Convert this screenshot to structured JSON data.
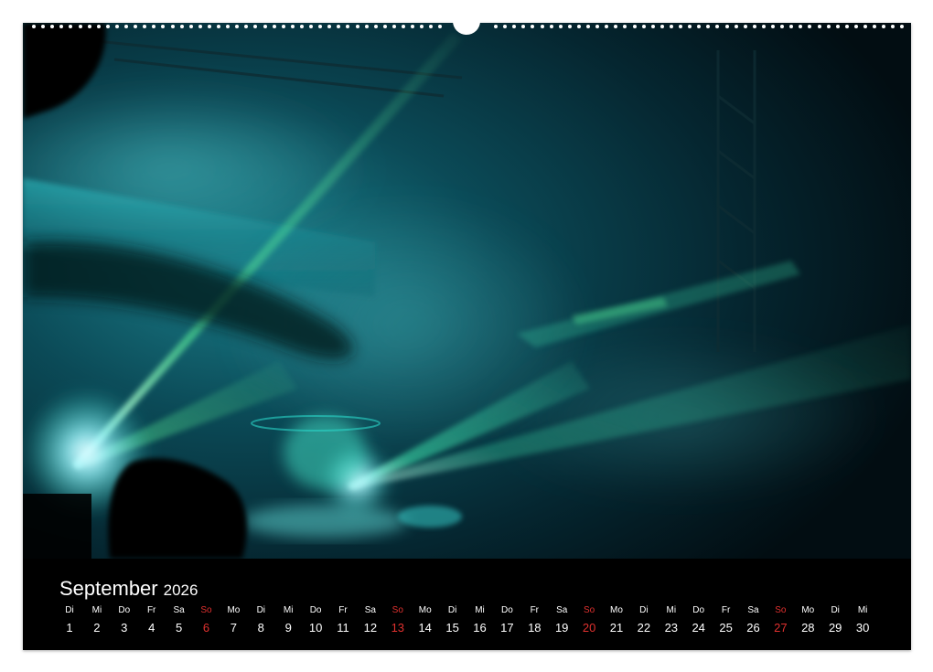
{
  "calendar": {
    "month": "September",
    "year": "2026",
    "weekday_labels": [
      "Di",
      "Mi",
      "Do",
      "Fr",
      "Sa",
      "So",
      "Mo",
      "Di",
      "Mi",
      "Do",
      "Fr",
      "Sa",
      "So",
      "Mo",
      "Di",
      "Mi",
      "Do",
      "Fr",
      "Sa",
      "So",
      "Mo",
      "Di",
      "Mi",
      "Do",
      "Fr",
      "Sa",
      "So",
      "Mo",
      "Di",
      "Mi"
    ],
    "dates": [
      "1",
      "2",
      "3",
      "4",
      "5",
      "6",
      "7",
      "8",
      "9",
      "10",
      "11",
      "12",
      "13",
      "14",
      "15",
      "16",
      "17",
      "18",
      "19",
      "20",
      "21",
      "22",
      "23",
      "24",
      "25",
      "26",
      "27",
      "28",
      "29",
      "30"
    ],
    "sundays": [
      6,
      13,
      20,
      27
    ],
    "sunday_color": "#e0312f",
    "text_color": "#ffffff"
  },
  "photo": {
    "subject": "laser-show-concert",
    "palette": [
      "#03141c",
      "#0a6f7a",
      "#29d6c8",
      "#5cf59a",
      "#ffffff"
    ]
  }
}
